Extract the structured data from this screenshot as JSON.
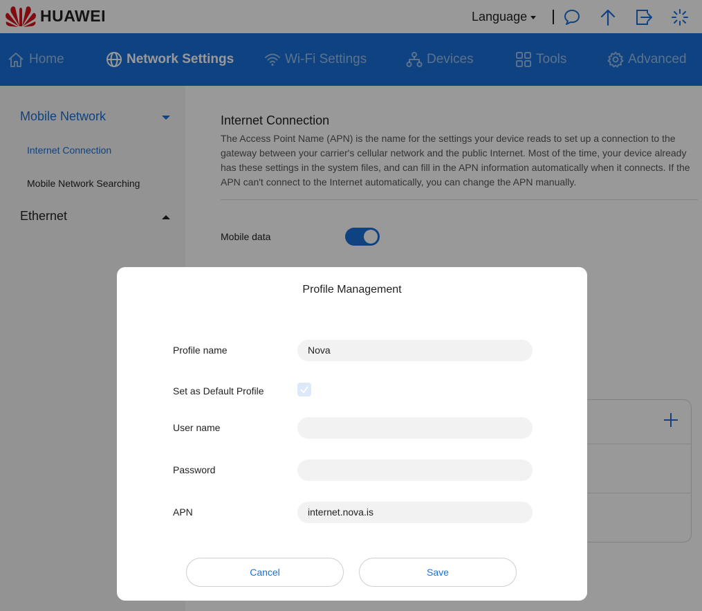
{
  "brand": {
    "name": "HUAWEI",
    "color": "#1a6fd6"
  },
  "header": {
    "language_label": "Language",
    "icons": [
      "chat-icon",
      "upload-arrow-icon",
      "logout-icon",
      "loading-icon"
    ]
  },
  "nav": {
    "items": [
      {
        "label": "Home",
        "icon": "home-icon",
        "active": false
      },
      {
        "label": "Network Settings",
        "icon": "globe-icon",
        "active": true
      },
      {
        "label": "Wi-Fi Settings",
        "icon": "wifi-icon",
        "active": false
      },
      {
        "label": "Devices",
        "icon": "devices-icon",
        "active": false
      },
      {
        "label": "Tools",
        "icon": "tools-icon",
        "active": false
      },
      {
        "label": "Advanced",
        "icon": "gear-icon",
        "active": false
      }
    ]
  },
  "sidebar": {
    "groups": [
      {
        "label": "Mobile Network",
        "expanded": true,
        "items": [
          {
            "label": "Internet Connection",
            "active": true
          },
          {
            "label": "Mobile Network Searching",
            "active": false
          }
        ]
      },
      {
        "label": "Ethernet",
        "expanded": false,
        "items": []
      }
    ]
  },
  "main": {
    "title": "Internet Connection",
    "description": "The Access Point Name (APN) is the name for the settings your device reads to set up a connection to the gateway between your carrier's cellular network and the public Internet. Most of the time, your device already has these settings in the system files, and can fill in the APN information automatically when it connects. If the APN can't connect to the Internet automatically, you can change the APN manually.",
    "mobile_data_label": "Mobile data",
    "mobile_data_on": true
  },
  "dialog": {
    "title": "Profile Management",
    "profile_name_label": "Profile name",
    "profile_name_value": "Nova",
    "default_profile_label": "Set as Default Profile",
    "default_profile_checked": true,
    "username_label": "User name",
    "username_value": "",
    "password_label": "Password",
    "password_value": "",
    "apn_label": "APN",
    "apn_value": "internet.nova.is",
    "cancel_label": "Cancel",
    "save_label": "Save"
  }
}
